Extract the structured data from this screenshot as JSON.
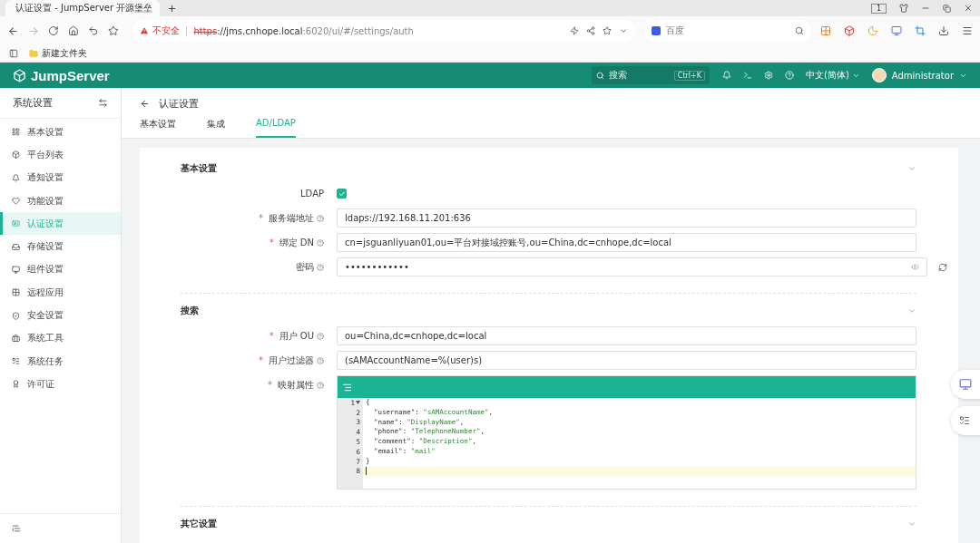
{
  "browser": {
    "tab_title": "认证设置 - JumpServer 开源堡垒",
    "tab_count": "1",
    "url": {
      "scheme": "https",
      "host": "://jms.cnhope.local",
      "rest": ":6020/ui/#/settings/auth"
    },
    "insecure_label": "不安全",
    "search_placeholder": "百度",
    "bookmark": "新建文件夹"
  },
  "header": {
    "logo": "JumpServer",
    "search_placeholder": "搜索",
    "shortcut": "Ctrl+K",
    "language": "中文(简体)",
    "user": "Administrator"
  },
  "sidebar": {
    "title": "系统设置",
    "items": [
      {
        "label": "基本设置",
        "selected": false
      },
      {
        "label": "平台列表",
        "selected": false
      },
      {
        "label": "通知设置",
        "selected": false
      },
      {
        "label": "功能设置",
        "selected": false
      },
      {
        "label": "认证设置",
        "selected": true
      },
      {
        "label": "存储设置",
        "selected": false
      },
      {
        "label": "组件设置",
        "selected": false
      },
      {
        "label": "远程应用",
        "selected": false
      },
      {
        "label": "安全设置",
        "selected": false
      },
      {
        "label": "系统工具",
        "selected": false
      },
      {
        "label": "系统任务",
        "selected": false
      },
      {
        "label": "许可证",
        "selected": false
      }
    ]
  },
  "page": {
    "title": "认证设置",
    "tabs": [
      {
        "label": "基本设置",
        "selected": false
      },
      {
        "label": "集成",
        "selected": false
      },
      {
        "label": "AD/LDAP",
        "selected": true
      }
    ]
  },
  "sections": [
    {
      "title": "基本设置",
      "fields": [
        {
          "kind": "checkbox",
          "label": "LDAP",
          "help": false,
          "checked": true
        },
        {
          "kind": "text",
          "label": "服务端地址",
          "required_mark": "*",
          "help": true,
          "value": "ldaps://192.168.11.201:636"
        },
        {
          "kind": "text",
          "label": "绑定 DN",
          "required_mark": "*",
          "help": true,
          "value": "cn=jsguanliyuan01,ou=平台对接域控账号,ou=China,dc=cnhope,dc=local"
        },
        {
          "kind": "password",
          "label": "密码",
          "help": true,
          "value": "••••••••••••"
        }
      ]
    },
    {
      "title": "搜索",
      "fields": [
        {
          "kind": "text",
          "label": "用户 OU",
          "required_mark": "*",
          "help": true,
          "value": "ou=China,dc=cnhope,dc=local"
        },
        {
          "kind": "text",
          "label": "用户过滤器",
          "required_mark": "*",
          "help": true,
          "value": "(sAMAccountName=%(user)s)"
        },
        {
          "kind": "code",
          "label": "映射属性",
          "required_mark": "*",
          "help": true,
          "lines": [
            "{",
            "  \"username\": \"sAMAccountName\",",
            "  \"name\": \"DisplayName\",",
            "  \"phone\": \"TelephoneNumber\",",
            "  \"comment\": \"Description\",",
            "  \"email\": \"mail\"",
            "}"
          ],
          "line_numbers": [
            "1",
            "2",
            "3",
            "4",
            "5",
            "6",
            "7",
            "8"
          ]
        }
      ]
    },
    {
      "title": "其它设置"
    }
  ]
}
